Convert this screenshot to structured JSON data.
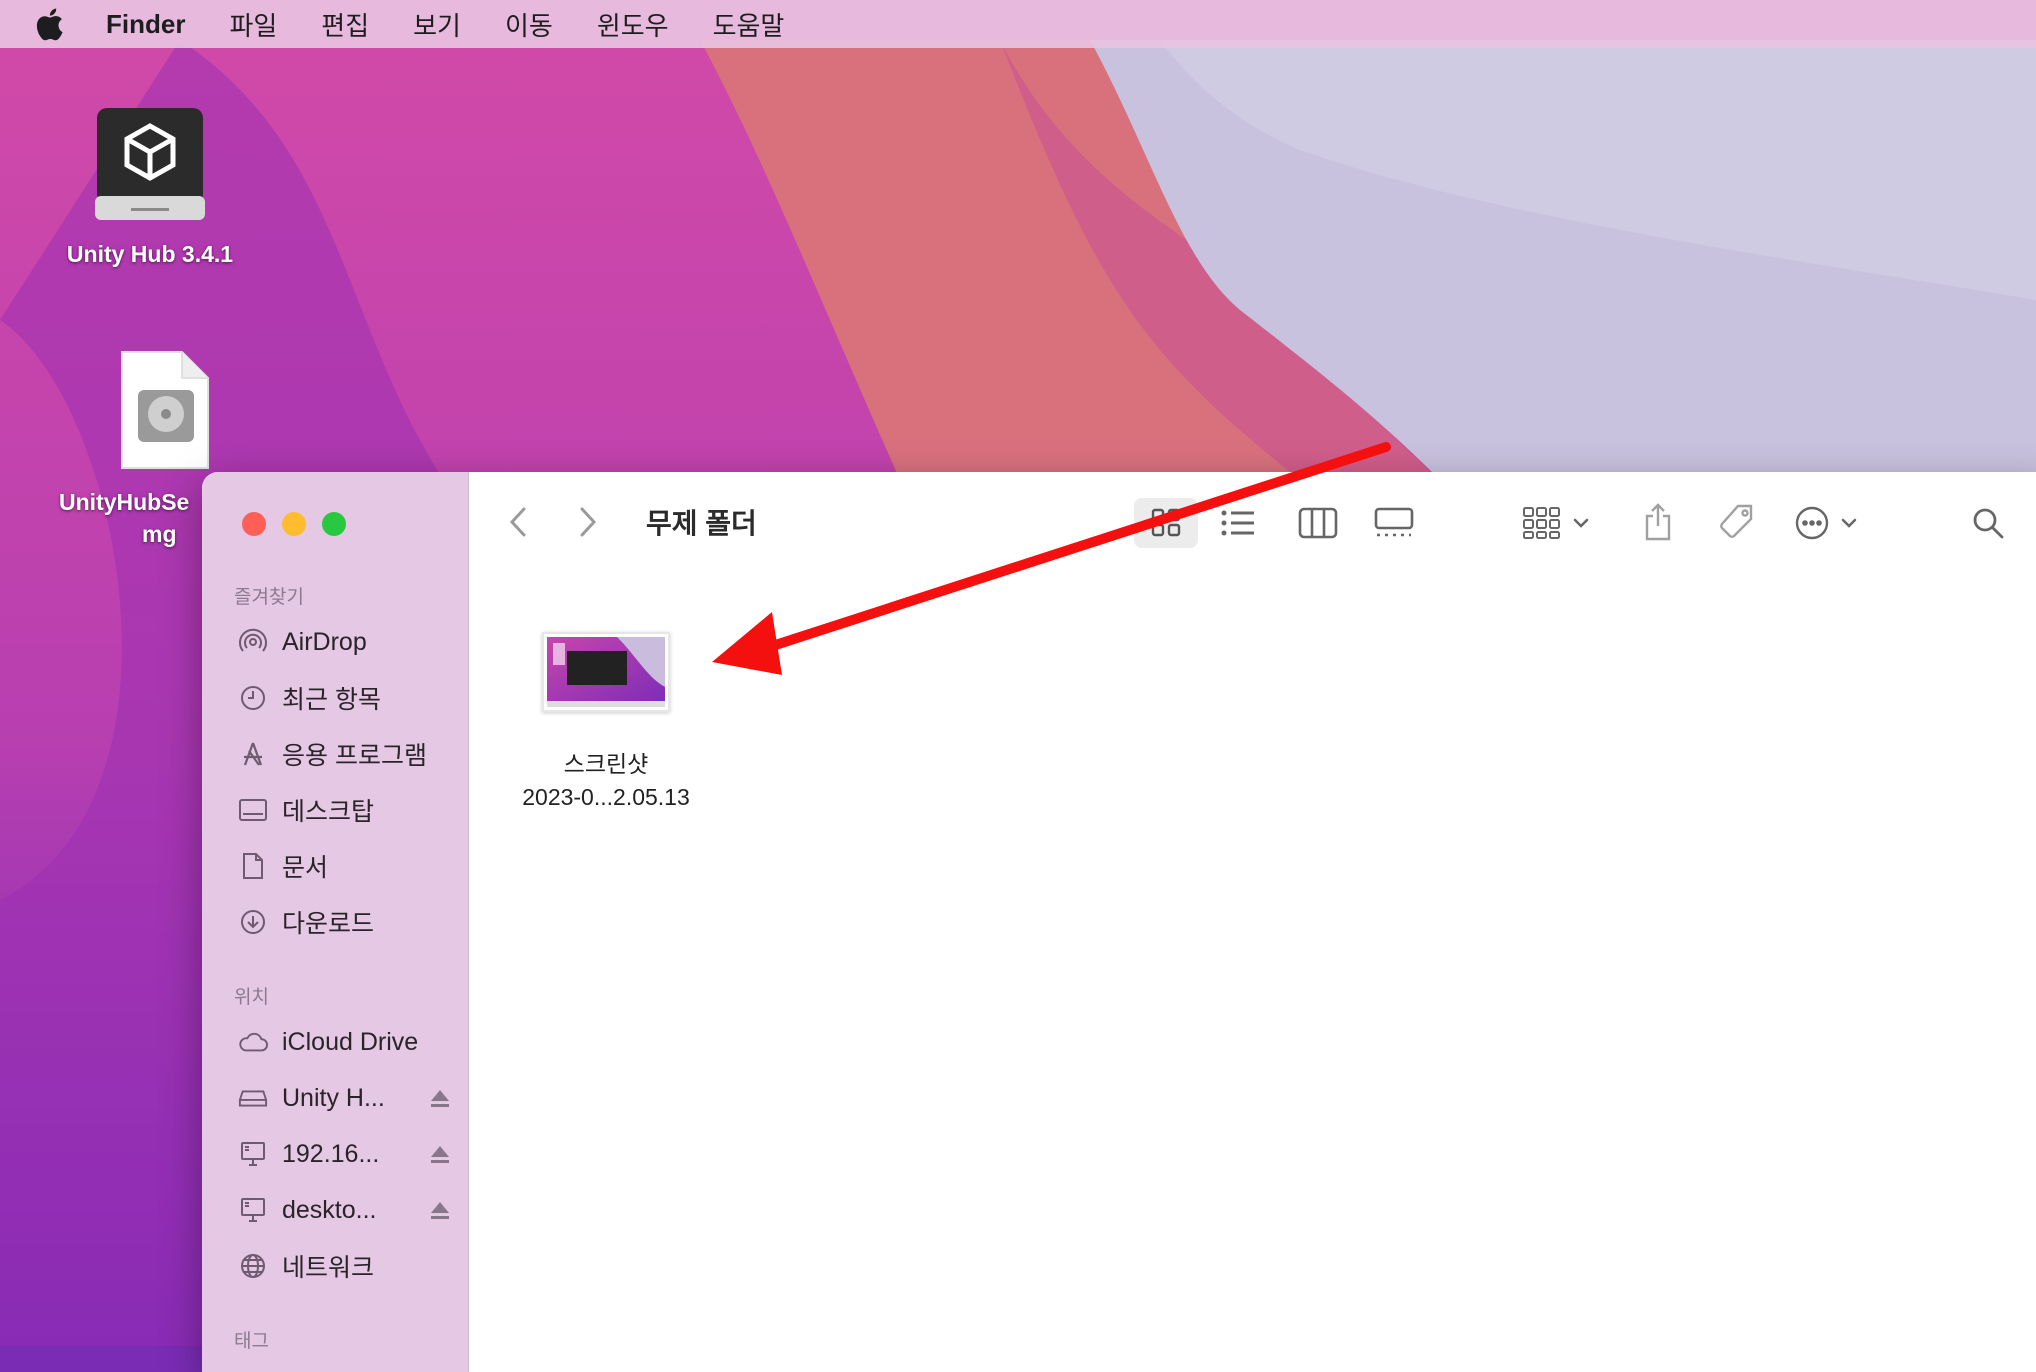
{
  "menubar": {
    "app_name": "Finder",
    "items": [
      "파일",
      "편집",
      "보기",
      "이동",
      "윈도우",
      "도움말"
    ]
  },
  "desktop": {
    "icons": [
      {
        "label": "Unity Hub 3.4.1"
      },
      {
        "label_line1": "UnityHubSe",
        "label_line2": "mg"
      }
    ]
  },
  "finder": {
    "title": "무제 폴더",
    "sidebar": {
      "favorites_title": "즐겨찾기",
      "favorites": [
        "AirDrop",
        "최근 항목",
        "응용 프로그램",
        "데스크탑",
        "문서",
        "다운로드"
      ],
      "locations_title": "위치",
      "locations": [
        "iCloud Drive",
        "Unity H...",
        "192.16...",
        "deskto...",
        "네트워크"
      ],
      "tags_title": "태그"
    },
    "files": [
      {
        "name_line1": "스크린샷",
        "name_line2": "2023-0...2.05.13"
      }
    ]
  },
  "colors": {
    "close": "#ff5f57",
    "minimize": "#febc2e",
    "zoom": "#28c840",
    "annotation_arrow": "#f51010"
  }
}
